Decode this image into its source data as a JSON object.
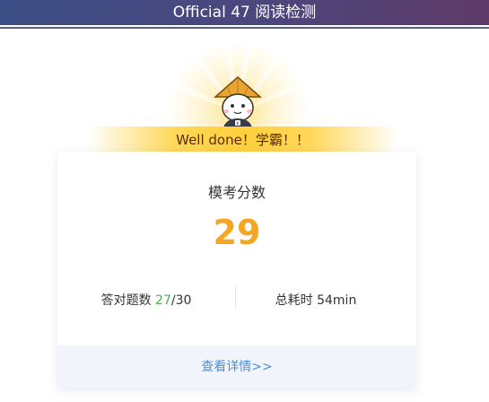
{
  "header": {
    "title": "Official 47 阅读检测"
  },
  "banner": {
    "text": "Well done！学霸！！"
  },
  "result": {
    "label": "模考分数",
    "score": "29",
    "correct_label": "答对题数",
    "correct_count": "27",
    "total_suffix": "/30",
    "time_label": "总耗时",
    "time_value": "54min"
  },
  "details_link": "查看详情>>",
  "colors": {
    "score": "#f5a623",
    "correct": "#4cb050",
    "link": "#4a8fd9",
    "banner": "#ffcf3c"
  }
}
